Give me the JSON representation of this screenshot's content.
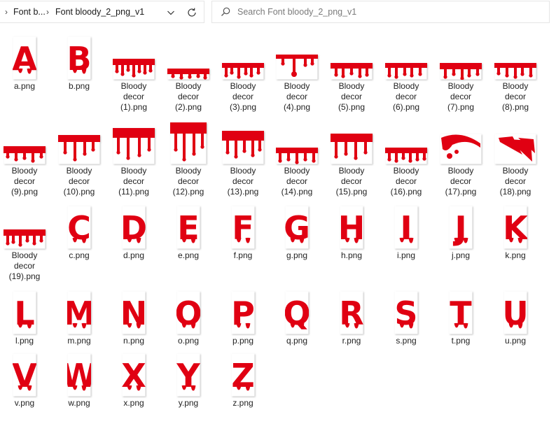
{
  "breadcrumb": {
    "parent": "Font b...",
    "current": "Font bloody_2_png_v1"
  },
  "search": {
    "placeholder": "Search Font bloody_2_png_v1"
  },
  "icons": {
    "chevron": "chevron-down-icon",
    "refresh": "refresh-icon",
    "search": "search-icon"
  },
  "colors": {
    "blood": "#e00012",
    "accent": "#0067c0"
  },
  "files": [
    {
      "label": [
        "a.png"
      ],
      "kind": "letter",
      "glyph": "A"
    },
    {
      "label": [
        "b.png"
      ],
      "kind": "letter",
      "glyph": "B"
    },
    {
      "label": [
        "Bloody",
        "decor",
        "(1).png"
      ],
      "kind": "decor"
    },
    {
      "label": [
        "Bloody",
        "decor",
        "(2).png"
      ],
      "kind": "decor"
    },
    {
      "label": [
        "Bloody",
        "decor",
        "(3).png"
      ],
      "kind": "decor"
    },
    {
      "label": [
        "Bloody",
        "decor",
        "(4).png"
      ],
      "kind": "decor"
    },
    {
      "label": [
        "Bloody",
        "decor",
        "(5).png"
      ],
      "kind": "decor"
    },
    {
      "label": [
        "Bloody",
        "decor",
        "(6).png"
      ],
      "kind": "decor"
    },
    {
      "label": [
        "Bloody",
        "decor",
        "(7).png"
      ],
      "kind": "decor"
    },
    {
      "label": [
        "Bloody",
        "decor",
        "(8).png"
      ],
      "kind": "decor"
    },
    {
      "label": [
        "Bloody",
        "decor",
        "(9).png"
      ],
      "kind": "decor"
    },
    {
      "label": [
        "Bloody",
        "decor",
        "(10).png"
      ],
      "kind": "decor"
    },
    {
      "label": [
        "Bloody",
        "decor",
        "(11).png"
      ],
      "kind": "decor"
    },
    {
      "label": [
        "Bloody",
        "decor",
        "(12).png"
      ],
      "kind": "decor"
    },
    {
      "label": [
        "Bloody",
        "decor",
        "(13).png"
      ],
      "kind": "decor"
    },
    {
      "label": [
        "Bloody",
        "decor",
        "(14).png"
      ],
      "kind": "decor"
    },
    {
      "label": [
        "Bloody",
        "decor",
        "(15).png"
      ],
      "kind": "decor"
    },
    {
      "label": [
        "Bloody",
        "decor",
        "(16).png"
      ],
      "kind": "decor"
    },
    {
      "label": [
        "Bloody",
        "decor",
        "(17).png"
      ],
      "kind": "decor"
    },
    {
      "label": [
        "Bloody",
        "decor",
        "(18).png"
      ],
      "kind": "decor"
    },
    {
      "label": [
        "Bloody",
        "decor",
        "(19).png"
      ],
      "kind": "decor"
    },
    {
      "label": [
        "c.png"
      ],
      "kind": "letter",
      "glyph": "C"
    },
    {
      "label": [
        "d.png"
      ],
      "kind": "letter",
      "glyph": "D"
    },
    {
      "label": [
        "e.png"
      ],
      "kind": "letter",
      "glyph": "E"
    },
    {
      "label": [
        "f.png"
      ],
      "kind": "letter",
      "glyph": "F"
    },
    {
      "label": [
        "g.png"
      ],
      "kind": "letter",
      "glyph": "G"
    },
    {
      "label": [
        "h.png"
      ],
      "kind": "letter",
      "glyph": "H"
    },
    {
      "label": [
        "i.png"
      ],
      "kind": "letter",
      "glyph": "I"
    },
    {
      "label": [
        "j.png"
      ],
      "kind": "letter",
      "glyph": "J"
    },
    {
      "label": [
        "k.png"
      ],
      "kind": "letter",
      "glyph": "K"
    },
    {
      "label": [
        "l.png"
      ],
      "kind": "letter",
      "glyph": "L"
    },
    {
      "label": [
        "m.png"
      ],
      "kind": "letter",
      "glyph": "M"
    },
    {
      "label": [
        "n.png"
      ],
      "kind": "letter",
      "glyph": "N"
    },
    {
      "label": [
        "o.png"
      ],
      "kind": "letter",
      "glyph": "O"
    },
    {
      "label": [
        "p.png"
      ],
      "kind": "letter",
      "glyph": "P"
    },
    {
      "label": [
        "q.png"
      ],
      "kind": "letter",
      "glyph": "Q"
    },
    {
      "label": [
        "r.png"
      ],
      "kind": "letter",
      "glyph": "R"
    },
    {
      "label": [
        "s.png"
      ],
      "kind": "letter",
      "glyph": "S"
    },
    {
      "label": [
        "t.png"
      ],
      "kind": "letter",
      "glyph": "T"
    },
    {
      "label": [
        "u.png"
      ],
      "kind": "letter",
      "glyph": "U"
    },
    {
      "label": [
        "v.png"
      ],
      "kind": "letter",
      "glyph": "V"
    },
    {
      "label": [
        "w.png"
      ],
      "kind": "letter",
      "glyph": "W"
    },
    {
      "label": [
        "x.png"
      ],
      "kind": "letter",
      "glyph": "X"
    },
    {
      "label": [
        "y.png"
      ],
      "kind": "letter",
      "glyph": "Y"
    },
    {
      "label": [
        "z.png"
      ],
      "kind": "letter",
      "glyph": "Z"
    }
  ]
}
